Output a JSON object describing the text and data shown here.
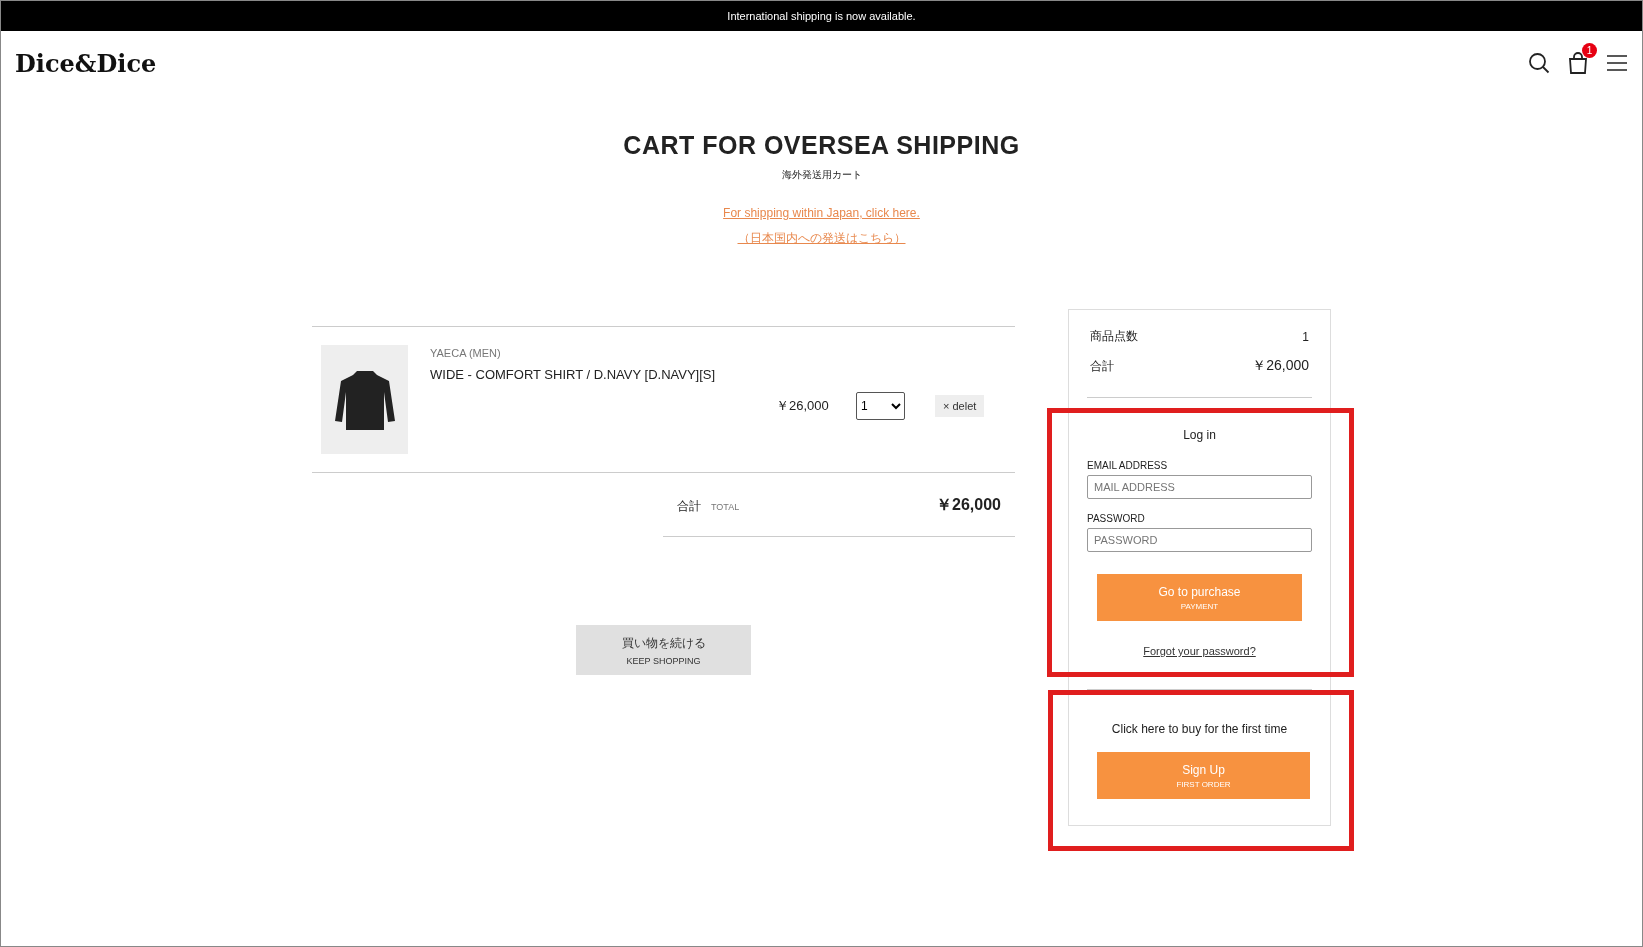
{
  "announcement": "International shipping is now available.",
  "header": {
    "logo": "Dice&Dice",
    "cart_count": "1"
  },
  "page": {
    "title": "CART FOR OVERSEA SHIPPING",
    "subtitle": "海外発送用カート",
    "links": [
      "For shipping within Japan, click here.",
      "（日本国内への発送はこちら）"
    ]
  },
  "cart": {
    "items": [
      {
        "brand": "YAECA (MEN)",
        "name": "WIDE - COMFORT SHIRT / D.NAVY [D.NAVY][S]",
        "price": "￥26,000",
        "quantity": "1",
        "delete": "× delet"
      }
    ],
    "total": {
      "label": "合計",
      "label_en": "TOTAL",
      "value": "￥26,000"
    },
    "keep_shopping": {
      "label": "買い物を続ける",
      "sub": "KEEP SHOPPING"
    }
  },
  "summary": {
    "rows": [
      {
        "label": "商品点数",
        "value": "1"
      },
      {
        "label": "合計",
        "value": "￥26,000"
      }
    ]
  },
  "login": {
    "highlighted": true,
    "title": "Log in",
    "fields": [
      {
        "label": "EMAIL ADDRESS",
        "placeholder": "MAIL ADDRESS"
      },
      {
        "label": "PASSWORD",
        "placeholder": "PASSWORD"
      }
    ],
    "button": {
      "label": "Go to purchase",
      "sub": "PAYMENT"
    },
    "forgot": "Forgot your password?"
  },
  "signup": {
    "highlighted": true,
    "prompt": "Click here to buy for the first time",
    "button": {
      "label": "Sign Up",
      "sub": "FIRST ORDER"
    }
  }
}
